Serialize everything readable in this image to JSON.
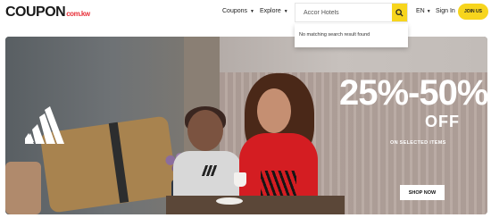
{
  "header": {
    "logo_main": "COUPON",
    "logo_domain": "com.kw",
    "nav": [
      {
        "label": "Coupons"
      },
      {
        "label": "Explore"
      }
    ],
    "search": {
      "value": "Accor Hotels",
      "dropdown_message": "No matching search result found"
    },
    "language": "EN",
    "sign_in": "Sign In",
    "join_us": "JOIN US"
  },
  "banner": {
    "headline": "25%-50%",
    "headline_sub": "OFF",
    "subtitle": "ON SELECTED ITEMS",
    "cta": "SHOP NOW",
    "brand_icon": "adidas-logo-icon"
  },
  "colors": {
    "accent": "#f7d51d",
    "logo_domain": "#e8313a",
    "hero_red": "#d41d22"
  }
}
